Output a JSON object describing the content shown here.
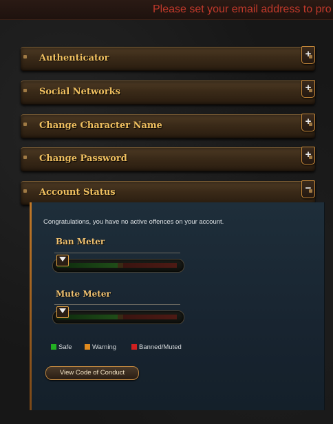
{
  "banner": {
    "text": "Please set your email address to pro"
  },
  "sections": [
    {
      "label": "Authenticator",
      "toggle": "+"
    },
    {
      "label": "Social Networks",
      "toggle": "+"
    },
    {
      "label": "Change Character Name",
      "toggle": "+"
    },
    {
      "label": "Change Password",
      "toggle": "+"
    },
    {
      "label": "Account Status",
      "toggle": "−"
    }
  ],
  "account_status": {
    "message": "Congratulations, you have no active offences on your account.",
    "ban_meter": {
      "title": "Ban Meter",
      "level": 0
    },
    "mute_meter": {
      "title": "Mute Meter",
      "level": 0
    },
    "legend": [
      {
        "label": "Safe",
        "color": "#22b022"
      },
      {
        "label": "Warning",
        "color": "#e08a1e"
      },
      {
        "label": "Banned/Muted",
        "color": "#d02020"
      }
    ],
    "button_label": "View Code of Conduct"
  }
}
